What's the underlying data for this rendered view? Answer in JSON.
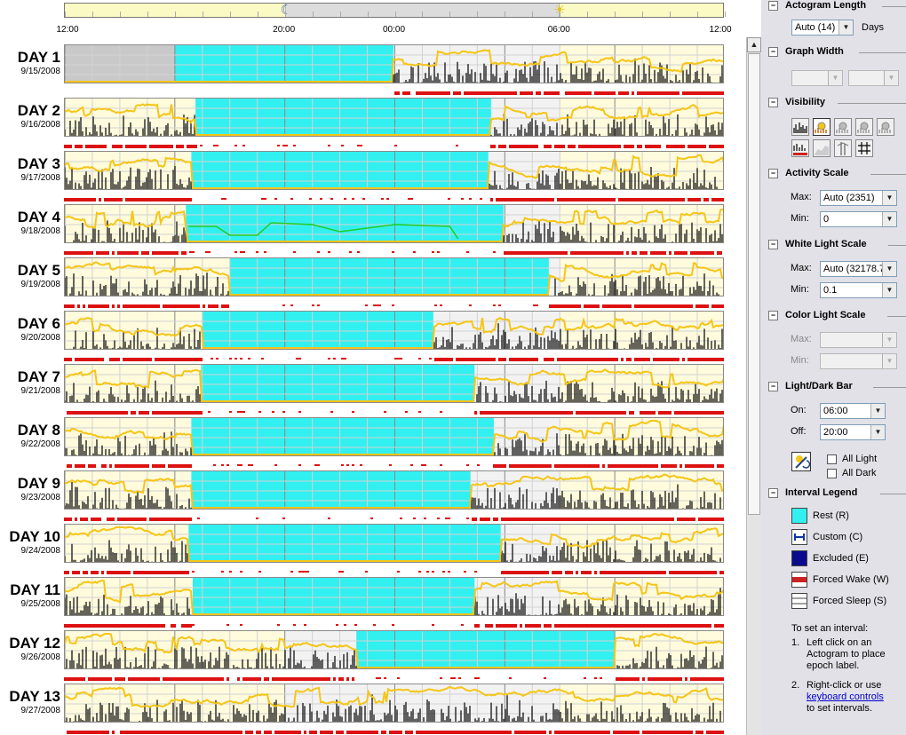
{
  "timeline": {
    "labels": [
      "12:00",
      "20:00",
      "00:00",
      "06:00",
      "12:00"
    ],
    "night_start_hour": 20,
    "night_end_hour": 6,
    "moon_icon": "moon-icon",
    "sun_icon": "sun-icon"
  },
  "days": [
    {
      "name": "DAY 1",
      "date": "9/15/2008",
      "rest_start": 16.0,
      "rest_end": 23.95,
      "light_rest": false
    },
    {
      "name": "DAY 2",
      "date": "9/16/2008",
      "rest_start": 16.75,
      "rest_end": 27.5,
      "light_rest": false
    },
    {
      "name": "DAY 3",
      "date": "9/17/2008",
      "rest_start": 16.6,
      "rest_end": 27.4,
      "light_rest": false
    },
    {
      "name": "DAY 4",
      "date": "9/18/2008",
      "rest_start": 16.4,
      "rest_end": 27.95,
      "light_rest": true
    },
    {
      "name": "DAY 5",
      "date": "9/19/2008",
      "rest_start": 18.0,
      "rest_end": 29.6,
      "light_rest": false
    },
    {
      "name": "DAY 6",
      "date": "9/20/2008",
      "rest_start": 17.0,
      "rest_end": 25.4,
      "light_rest": false
    },
    {
      "name": "DAY 7",
      "date": "9/21/2008",
      "rest_start": 16.95,
      "rest_end": 26.9,
      "light_rest": false
    },
    {
      "name": "DAY 8",
      "date": "9/22/2008",
      "rest_start": 16.6,
      "rest_end": 27.6,
      "light_rest": false
    },
    {
      "name": "DAY 9",
      "date": "9/23/2008",
      "rest_start": 16.6,
      "rest_end": 26.75,
      "light_rest": false
    },
    {
      "name": "DAY 10",
      "date": "9/24/2008",
      "rest_start": 16.5,
      "rest_end": 27.85,
      "light_rest": false
    },
    {
      "name": "DAY 11",
      "date": "9/25/2008",
      "rest_start": 16.65,
      "rest_end": 26.9,
      "light_rest": false
    },
    {
      "name": "DAY 12",
      "date": "9/26/2008",
      "rest_start": 22.6,
      "rest_end": 32.0,
      "light_rest": false
    },
    {
      "name": "DAY 13",
      "date": "9/27/2008",
      "rest_start": 0,
      "rest_end": 0.8,
      "light_rest": false
    }
  ],
  "colors": {
    "rest": "#33f0f0",
    "light": "#f5c518",
    "activity": "#000000",
    "wake_bar": "#dd1111",
    "day_bg": "#fffbdc",
    "night_bg": "#f2f2f2",
    "excluded_gray": "#c9c9c9",
    "green": "#22cc22"
  },
  "panel": {
    "actogram_length": {
      "title": "Actogram Length",
      "value": "Auto (14)",
      "unit": "Days"
    },
    "graph_width": {
      "title": "Graph Width"
    },
    "visibility": {
      "title": "Visibility",
      "buttons": [
        "activity-toggle-icon",
        "light-white-toggle-icon",
        "light-red-toggle-icon",
        "light-green-toggle-icon",
        "light-blue-toggle-icon",
        "wake-bar-toggle-icon",
        "light-area-toggle-icon",
        "marker-toggle-icon",
        "grid-toggle-icon"
      ]
    },
    "activity_scale": {
      "title": "Activity Scale",
      "max_label": "Max:",
      "max_value": "Auto (2351)",
      "min_label": "Min:",
      "min_value": "0"
    },
    "white_light_scale": {
      "title": "White Light Scale",
      "max_label": "Max:",
      "max_value": "Auto (32178.7",
      "min_label": "Min:",
      "min_value": "0.1"
    },
    "color_light_scale": {
      "title": "Color Light Scale",
      "max_label": "Max:",
      "min_label": "Min:"
    },
    "light_dark_bar": {
      "title": "Light/Dark Bar",
      "on_label": "On:",
      "on_value": "06:00",
      "off_label": "Off:",
      "off_value": "20:00",
      "all_light": "All Light",
      "all_dark": "All Dark"
    },
    "interval_legend": {
      "title": "Interval Legend",
      "items": [
        {
          "label": "Rest (R)",
          "color": "#33f0f0"
        },
        {
          "label": "Custom (C)",
          "color": "#ffffff"
        },
        {
          "label": "Excluded (E)",
          "color": "#0a0a8c"
        },
        {
          "label": "Forced Wake (W)",
          "color": "#cc2222"
        },
        {
          "label": "Forced Sleep (S)",
          "color": "#ffffff"
        }
      ]
    },
    "help": {
      "intro": "To set an interval:",
      "step1_num": "1.",
      "step1": "Left click on an Actogram to place epoch label.",
      "step2_num": "2.",
      "step2_pre": "Right-click or use",
      "step2_link": "keyboard controls",
      "step2_post": "to set intervals."
    }
  }
}
